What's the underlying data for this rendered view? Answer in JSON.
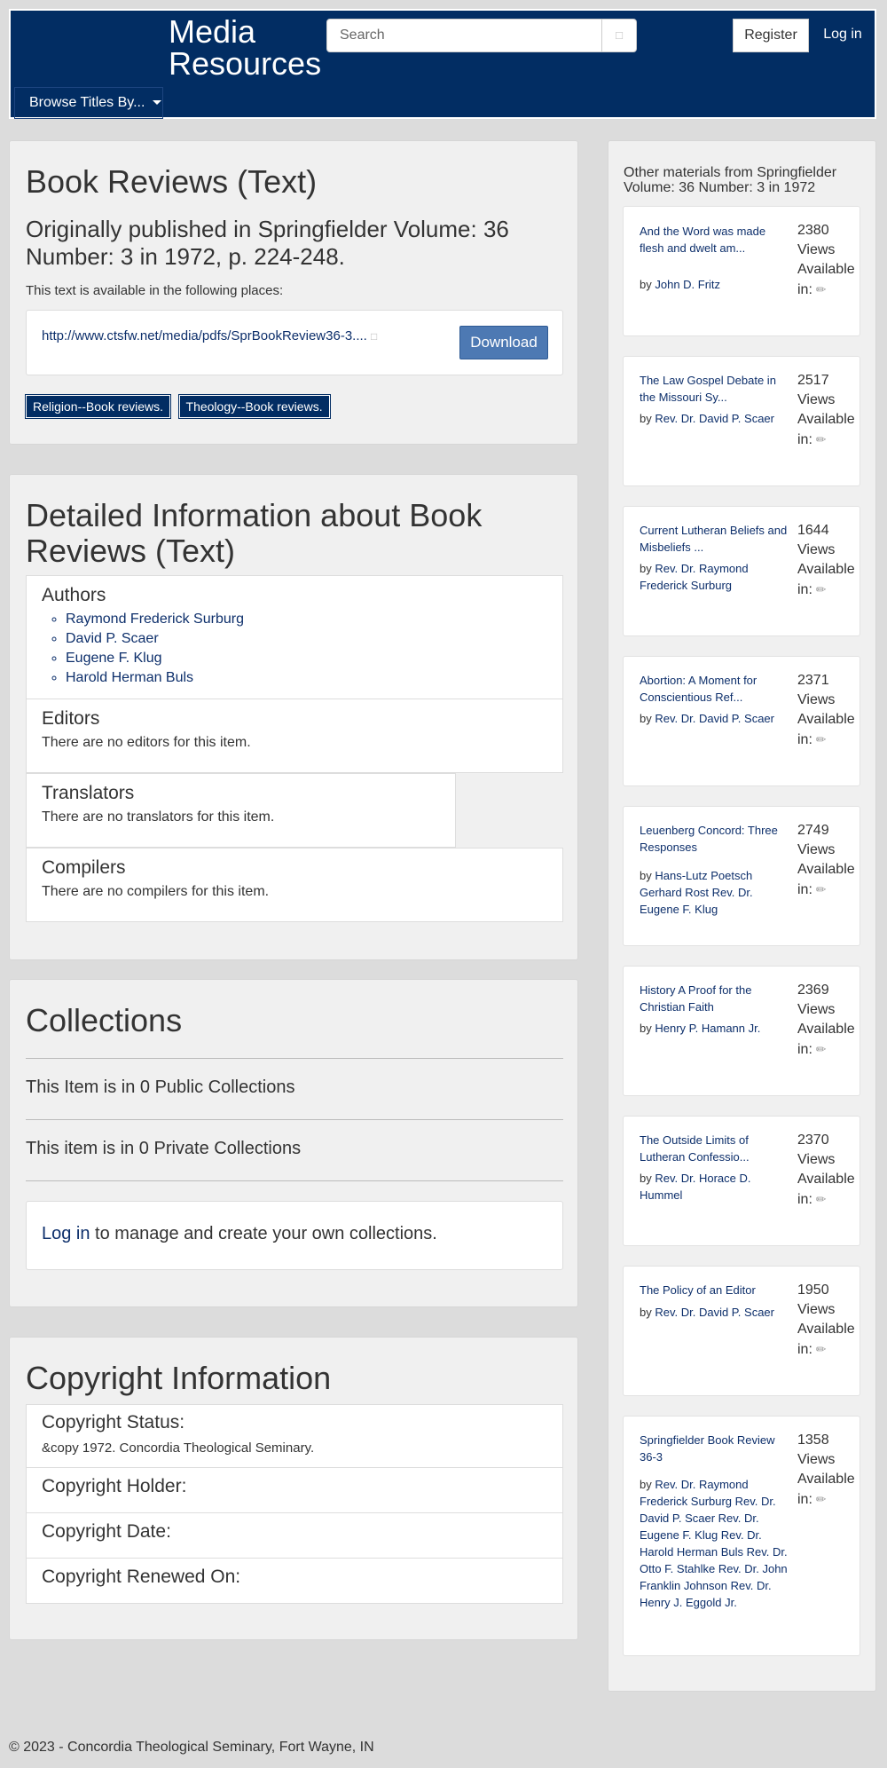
{
  "header": {
    "brand_line1": "Media",
    "brand_line2": "Resources",
    "search_placeholder": "Search",
    "search_icon": "search-icon",
    "register_label": "Register",
    "login_label": "Log in",
    "browse_label": "Browse Titles By..."
  },
  "item": {
    "title": "Book Reviews (Text)",
    "published": "Originally published in Springfielder Volume: 36 Number: 3 in 1972, p. 224-248.",
    "available_text": "This text is available in the following places:",
    "link": "http://www.ctsfw.net/media/pdfs/SprBookReview36-3....",
    "external_icon": "external-link-icon",
    "download_label": "Download",
    "tags": [
      "Religion--Book reviews.",
      "Theology--Book reviews."
    ]
  },
  "details": {
    "title": "Detailed Information about Book Reviews (Text)",
    "authors_title": "Authors",
    "authors": [
      "Raymond Frederick Surburg",
      "David P. Scaer",
      "Eugene F. Klug",
      "Harold Herman Buls"
    ],
    "editors_title": "Editors",
    "editors_text": "There are no editors for this item.",
    "translators_title": "Translators",
    "translators_text": "There are no translators for this item.",
    "compilers_title": "Compilers",
    "compilers_text": "There are no compilers for this item."
  },
  "collections": {
    "title": "Collections",
    "public_text": "This Item is in 0 Public Collections",
    "private_text": "This item is in 0 Private Collections",
    "login_link": "Log in",
    "login_suffix": " to manage and create your own collections."
  },
  "copyright": {
    "title": "Copyright Information",
    "status_label": "Copyright Status:",
    "status_value": "&copy 1972. Concordia Theological Seminary.",
    "holder_label": "Copyright Holder:",
    "date_label": "Copyright Date:",
    "renewed_label": "Copyright Renewed On:"
  },
  "sidebar": {
    "heading": "Other materials from Springfielder Volume: 36 Number: 3 in 1972",
    "views_word": "Views",
    "available_word": "Available",
    "in_word": "in:",
    "by_word": "by",
    "items": [
      {
        "title": "And the Word was made flesh and dwelt am...",
        "authors": "John D. Fritz",
        "views": "2380"
      },
      {
        "title": "The Law Gospel Debate in the Missouri Sy...",
        "authors": "Rev. Dr. David P. Scaer",
        "views": "2517"
      },
      {
        "title": "Current Lutheran Beliefs and Misbeliefs ...",
        "authors": "Rev. Dr. Raymond Frederick Surburg",
        "views": "1644"
      },
      {
        "title": "Abortion: A Moment for Conscientious Ref...",
        "authors": "Rev. Dr. David P. Scaer",
        "views": "2371"
      },
      {
        "title": "Leuenberg Concord: Three Responses",
        "authors": "Hans-Lutz Poetsch Gerhard Rost Rev. Dr. Eugene F. Klug",
        "views": "2749"
      },
      {
        "title": "History A Proof for the Christian Faith",
        "authors": "Henry P. Hamann Jr.",
        "views": "2369"
      },
      {
        "title": "The Outside Limits of Lutheran Confessio...",
        "authors": "Rev. Dr. Horace D. Hummel",
        "views": "2370"
      },
      {
        "title": "The Policy of an Editor",
        "authors": "Rev. Dr. David P. Scaer",
        "views": "1950"
      },
      {
        "title": "Springfielder Book Review 36-3",
        "authors": "Rev. Dr. Raymond Frederick Surburg Rev. Dr. David P. Scaer Rev. Dr. Eugene F. Klug Rev. Dr. Harold Herman Buls Rev. Dr. Otto F. Stahlke Rev. Dr. John Franklin Johnson Rev. Dr. Henry J. Eggold Jr.",
        "views": "1358"
      }
    ]
  },
  "footer": {
    "text": "© 2023 - Concordia Theological Seminary, Fort Wayne, IN"
  }
}
